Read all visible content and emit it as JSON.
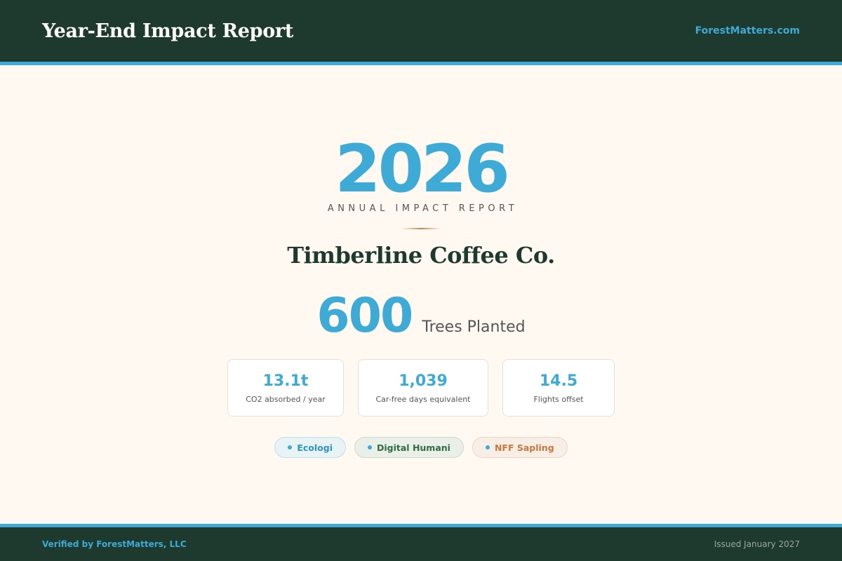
{
  "header": {
    "title": "Year-End Impact Report",
    "site_link": "ForestMatters.com"
  },
  "hero": {
    "year": "2026",
    "subtitle": "ANNUAL IMPACT REPORT",
    "company": "Timberline Coffee Co.",
    "trees_count": "600",
    "trees_label": "Trees Planted"
  },
  "stats": [
    {
      "value": "13.1t",
      "label": "CO2 absorbed / year"
    },
    {
      "value": "1,039",
      "label": "Car-free days equivalent"
    },
    {
      "value": "14.5",
      "label": "Flights offset"
    }
  ],
  "partners": [
    "Ecologi",
    "Digital Humani",
    "NFF Sapling"
  ],
  "footer": {
    "verified": "Verified by ForestMatters, LLC",
    "issued": "Issued January 2027"
  },
  "colors": {
    "brand_dark": "#1e3a2e",
    "accent": "#3eaad6",
    "background": "#fff9f2",
    "divider": "#cd8246"
  }
}
